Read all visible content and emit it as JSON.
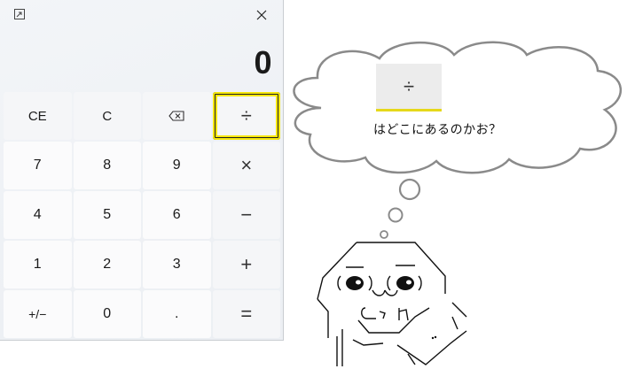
{
  "calculator": {
    "display_value": "0",
    "rows": [
      [
        "CE",
        "C",
        "⌫",
        "÷"
      ],
      [
        "7",
        "8",
        "9",
        "×"
      ],
      [
        "4",
        "5",
        "6",
        "−"
      ],
      [
        "1",
        "2",
        "3",
        "+"
      ],
      [
        "+/−",
        "0",
        ".",
        "="
      ]
    ],
    "highlighted_key": "÷",
    "title_icons": [
      "keep-on-top-icon",
      "close-icon"
    ]
  },
  "thought_bubble": {
    "button_label": "÷",
    "question": "はどこにあるのかお？"
  },
  "colors": {
    "highlight_outline": "#f5e60b",
    "window_bg": "#f0f2f5"
  }
}
